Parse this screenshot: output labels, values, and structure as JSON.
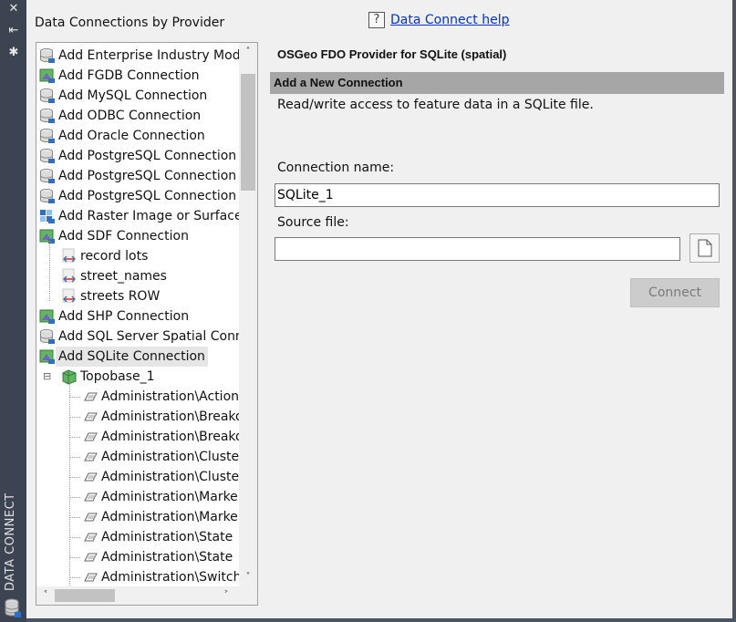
{
  "strip": {
    "title": "DATA CONNECT",
    "close_glyph": "✕",
    "autohide_glyph": "⇤",
    "gear_glyph": "✱"
  },
  "left_panel": {
    "title": "Data Connections by Provider"
  },
  "tree": {
    "items": [
      {
        "label": "Add Enterprise Industry Model",
        "icon": "database-icon",
        "level": 0
      },
      {
        "label": "Add FGDB Connection",
        "icon": "vector-layer-icon",
        "level": 0
      },
      {
        "label": "Add MySQL Connection",
        "icon": "database-icon",
        "level": 0
      },
      {
        "label": "Add ODBC Connection",
        "icon": "database-icon",
        "level": 0
      },
      {
        "label": "Add Oracle Connection",
        "icon": "database-icon",
        "level": 0
      },
      {
        "label": "Add PostgreSQL Connection",
        "icon": "database-icon",
        "level": 0
      },
      {
        "label": "Add PostgreSQL Connection",
        "icon": "database-icon",
        "level": 0
      },
      {
        "label": "Add PostgreSQL Connection",
        "icon": "database-icon",
        "level": 0
      },
      {
        "label": "Add Raster Image or Surface",
        "icon": "raster-icon",
        "level": 0
      },
      {
        "label": "Add SDF Connection",
        "icon": "vector-layer-icon",
        "level": 0
      },
      {
        "label": "record lots",
        "icon": "broken-connection-icon",
        "level": 1
      },
      {
        "label": "street_names",
        "icon": "broken-connection-icon",
        "level": 1
      },
      {
        "label": "streets ROW",
        "icon": "broken-connection-icon",
        "level": 1
      },
      {
        "label": "Add SHP Connection",
        "icon": "vector-layer-icon",
        "level": 0
      },
      {
        "label": "Add SQL Server Spatial Connection",
        "icon": "database-icon",
        "level": 0
      },
      {
        "label": "Add SQLite Connection",
        "icon": "vector-layer-icon",
        "level": 0,
        "selected": true
      },
      {
        "label": "Topobase_1",
        "icon": "topobase-icon",
        "level": 1,
        "expander": "⊟"
      },
      {
        "label": "Administration\\ActionMap",
        "icon": "feature-class-icon",
        "level": 2
      },
      {
        "label": "Administration\\BreakoutTable",
        "icon": "feature-class-icon",
        "level": 2
      },
      {
        "label": "Administration\\BreakoutRule",
        "icon": "feature-class-icon",
        "level": 2
      },
      {
        "label": "Administration\\ClusterTable",
        "icon": "feature-class-icon",
        "level": 2
      },
      {
        "label": "Administration\\ClusterRule",
        "icon": "feature-class-icon",
        "level": 2
      },
      {
        "label": "Administration\\Marker",
        "icon": "feature-class-icon",
        "level": 2
      },
      {
        "label": "Administration\\MarkerRule",
        "icon": "feature-class-icon",
        "level": 2
      },
      {
        "label": "Administration\\State",
        "icon": "feature-class-icon",
        "level": 2
      },
      {
        "label": "Administration\\State",
        "icon": "feature-class-icon",
        "level": 2
      },
      {
        "label": "Administration\\Switch",
        "icon": "feature-class-icon",
        "level": 2
      }
    ]
  },
  "help": {
    "icon_glyph": "?",
    "label": "Data Connect help"
  },
  "detail": {
    "provider_title": "OSGeo FDO Provider for SQLite (spatial)",
    "section_title": "Add a New Connection",
    "description": "Read/write access to feature data in a SQLite file.",
    "connection_name_label": "Connection name:",
    "connection_name_value": "SQLite_1",
    "source_file_label": "Source file:",
    "source_file_value": "",
    "connect_label": "Connect"
  },
  "colors": {
    "panel_bg": "#f0f0f0",
    "section_bar": "#a6a6a6",
    "link": "#0033cc",
    "strip": "#3c4452"
  }
}
